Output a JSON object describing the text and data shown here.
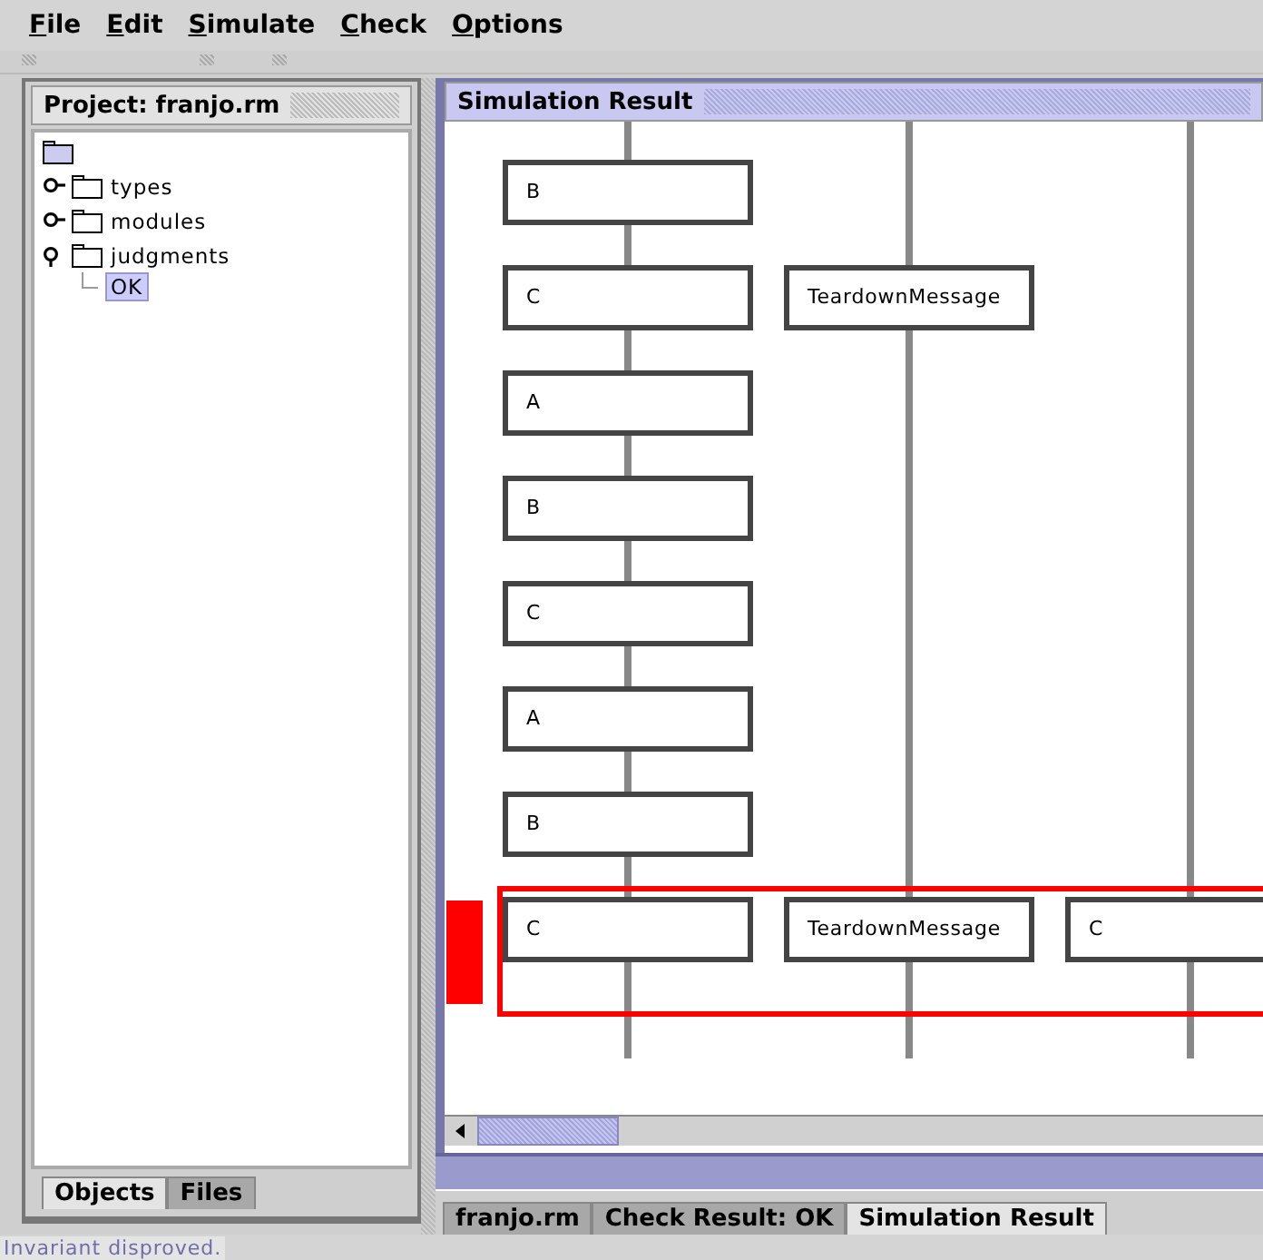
{
  "menu": [
    "File",
    "Edit",
    "Simulate",
    "Check",
    "Options"
  ],
  "project_panel": {
    "title": "Project: franjo.rm",
    "tree": {
      "children": [
        {
          "label": "types",
          "expanded": false
        },
        {
          "label": "modules",
          "expanded": false
        },
        {
          "label": "judgments",
          "expanded": true,
          "children": [
            {
              "label": "OK",
              "selected": true
            }
          ]
        }
      ]
    },
    "tabs": [
      {
        "label": "Objects",
        "selected": true
      },
      {
        "label": "Files",
        "selected": false
      }
    ]
  },
  "simulation_panel": {
    "title": "Simulation Result",
    "steps": [
      {
        "highlighted": false,
        "lane_1": "B"
      },
      {
        "highlighted": false,
        "lane_1": "C",
        "lane_2": "TeardownMessage"
      },
      {
        "highlighted": false,
        "lane_1": "A"
      },
      {
        "highlighted": false,
        "lane_1": "B"
      },
      {
        "highlighted": false,
        "lane_1": "C"
      },
      {
        "highlighted": false,
        "lane_1": "A"
      },
      {
        "highlighted": false,
        "lane_1": "B"
      },
      {
        "highlighted": true,
        "lane_1": "C",
        "lane_2": "TeardownMessage",
        "lane_3": "C"
      }
    ]
  },
  "editor_tabs": [
    {
      "label": "franjo.rm",
      "selected": false
    },
    {
      "label": "Check Result: OK",
      "selected": false
    },
    {
      "label": "Simulation Result",
      "selected": true
    }
  ],
  "status_bar": "Invariant disproved."
}
